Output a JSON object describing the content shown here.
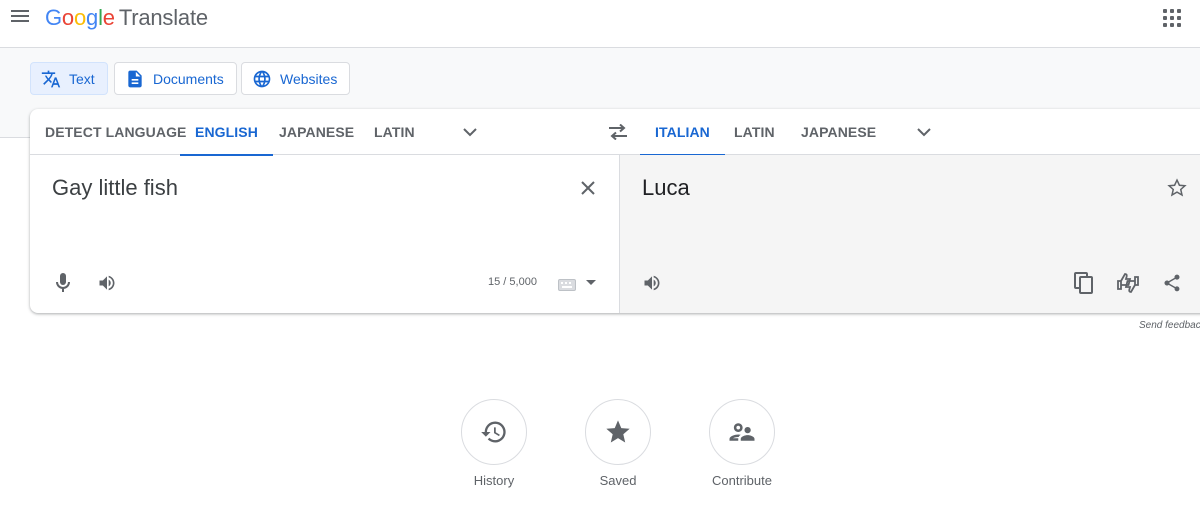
{
  "header": {
    "logo_letters": [
      "G",
      "o",
      "o",
      "g",
      "l",
      "e"
    ],
    "product": "Translate"
  },
  "modes": [
    {
      "label": "Text",
      "icon": "translate-icon",
      "active": true
    },
    {
      "label": "Documents",
      "icon": "document-icon",
      "active": false
    },
    {
      "label": "Websites",
      "icon": "globe-icon",
      "active": false
    }
  ],
  "source_langs": [
    "DETECT LANGUAGE",
    "ENGLISH",
    "JAPANESE",
    "LATIN"
  ],
  "source_active": "ENGLISH",
  "target_langs": [
    "ITALIAN",
    "LATIN",
    "JAPANESE"
  ],
  "target_active": "ITALIAN",
  "source": {
    "text": "Gay little fish",
    "char_count": "15 / 5,000"
  },
  "target": {
    "text": "Luca"
  },
  "feedback": "Send feedback",
  "bottom": [
    {
      "label": "History",
      "icon": "history-icon"
    },
    {
      "label": "Saved",
      "icon": "star-icon"
    },
    {
      "label": "Contribute",
      "icon": "people-icon"
    }
  ],
  "colors": {
    "accent": "#1967d2",
    "active_bg": "#e8f0fe",
    "target_bg": "#f5f5f5"
  }
}
